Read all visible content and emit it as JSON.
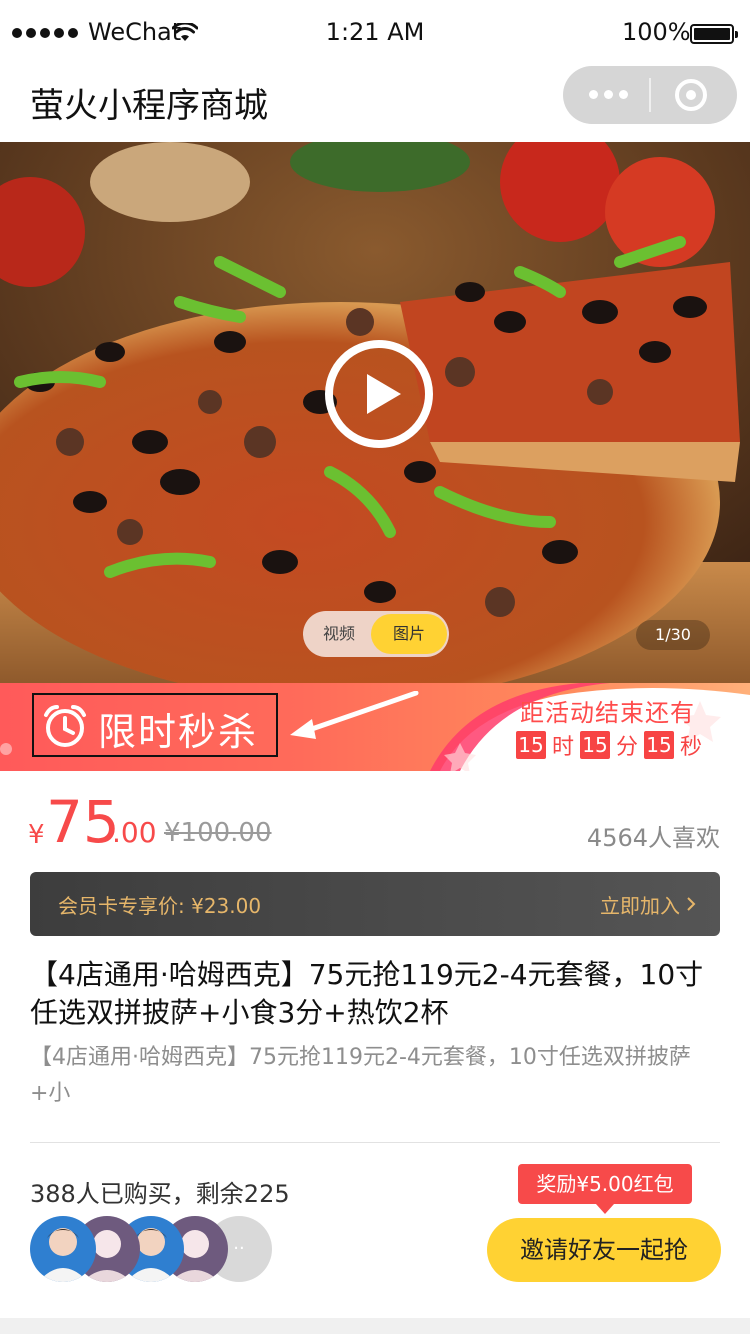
{
  "status_bar": {
    "carrier": "WeChat",
    "time": "1:21 AM",
    "battery": "100%",
    "battery_level": 1.0,
    "icons": [
      "signal-dots-icon",
      "wifi-icon",
      "battery-icon"
    ]
  },
  "nav": {
    "title": "萤火小程序商城",
    "icons": [
      "more-icon",
      "close-miniprogram-icon"
    ]
  },
  "media": {
    "image_subject": "pizza",
    "icons": [
      "play-icon"
    ],
    "toggle": {
      "video_label": "视频",
      "photo_label": "图片",
      "selected": "图片"
    },
    "counter": "1/30"
  },
  "flash_sale": {
    "label": "限时秒杀",
    "icons": [
      "alarm-clock-icon",
      "arrow-left-icon"
    ],
    "countdown_title": "距活动结束还有",
    "hours": "15",
    "hours_unit": "时",
    "minutes": "15",
    "minutes_unit": "分",
    "seconds": "15",
    "seconds_unit": "秒"
  },
  "price": {
    "currency": "¥",
    "integer": "75",
    "decimal": ".00",
    "original": "¥100.00",
    "likes": "4564人喜欢"
  },
  "member": {
    "text": "会员卡专享价: ¥23.00",
    "join_label": "立即加入",
    "icons": [
      "chevron-right-icon"
    ]
  },
  "product": {
    "title": "【4店通用·哈姆西克】75元抢119元2-4元套餐，10寸任选双拼披萨+小食3分+热饮2杯",
    "subtitle": "【4店通用·哈姆西克】75元抢119元2-4元套餐，10寸任选双拼披萨+小"
  },
  "group_buy": {
    "sold": "388人已购买，剩余225",
    "more_avatars": "··",
    "reward": "奖励¥5.00红包",
    "invite_label": "邀请好友一起抢"
  },
  "colors": {
    "accent_red": "#f74a4a",
    "accent_yellow": "#ffd233",
    "member_gold": "#e6b66a",
    "member_bg": "#3d3d3d"
  }
}
